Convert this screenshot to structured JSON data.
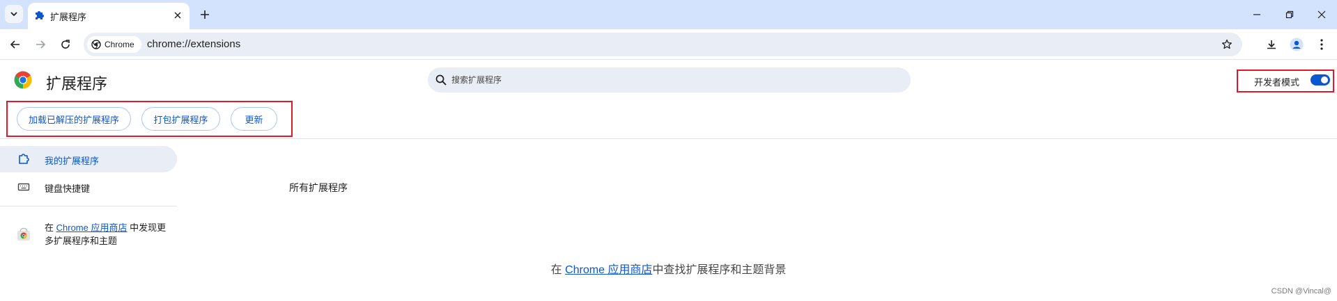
{
  "tabstrip": {
    "tab_title": "扩展程序",
    "icons": {
      "tab_search": "chevron-down-icon",
      "tab_favicon": "puzzle-icon",
      "tab_close": "close-icon",
      "new_tab": "plus-icon"
    },
    "window_controls": [
      "minimize-icon",
      "restore-icon",
      "close-icon"
    ]
  },
  "toolbar": {
    "chip_label": "Chrome",
    "url": "chrome://extensions",
    "icons": [
      "back-icon",
      "forward-icon",
      "reload-icon",
      "bookmark-star-icon",
      "download-icon",
      "profile-icon",
      "menu-icon"
    ]
  },
  "header": {
    "title": "扩展程序",
    "search_placeholder": "搜索扩展程序",
    "dev_mode_label": "开发者模式",
    "dev_mode_on": true
  },
  "dev_actions": {
    "load_unpacked": "加载已解压的扩展程序",
    "pack": "打包扩展程序",
    "update": "更新"
  },
  "sidebar": {
    "items": [
      {
        "label": "我的扩展程序",
        "active": true,
        "icon": "extension-icon"
      },
      {
        "label": "键盘快捷键",
        "active": false,
        "icon": "keyboard-icon"
      }
    ],
    "store_prefix": "在 ",
    "store_link": "Chrome 应用商店",
    "store_suffix": " 中发现更多扩展程序和主题"
  },
  "main": {
    "section_title": "所有扩展程序",
    "empty_prefix": "在 ",
    "empty_link": "Chrome 应用商店",
    "empty_suffix": "中查找扩展程序和主题背景"
  },
  "watermark": "CSDN @Vincal@",
  "colors": {
    "accent": "#0b57d0",
    "highlight": "#e0182d",
    "tabstrip": "#d3e3fd",
    "omnibox": "#e9eef6"
  }
}
